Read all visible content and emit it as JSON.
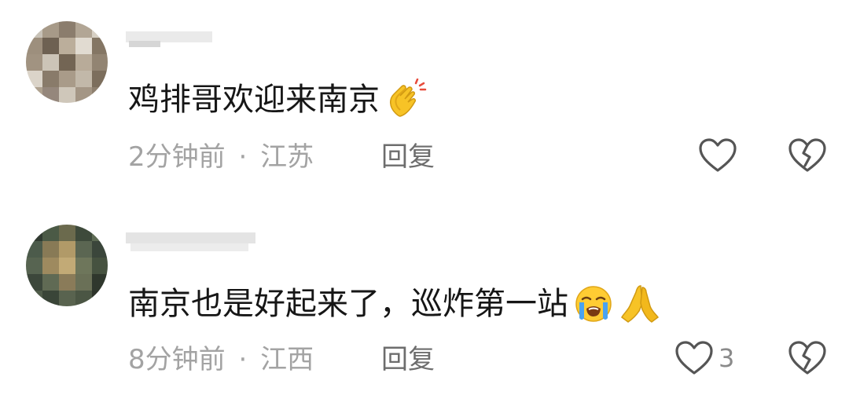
{
  "comments": [
    {
      "text": "鸡排哥欢迎来南京",
      "emojis": [
        "clapping-hands-emoji"
      ],
      "time": "2分钟前",
      "separator": "·",
      "location": "江苏",
      "reply_label": "回复",
      "like_count": ""
    },
    {
      "text": "南京也是好起来了，巡炸第一站",
      "emojis": [
        "loudly-crying-face-emoji",
        "folded-hands-emoji"
      ],
      "time": "8分钟前",
      "separator": "·",
      "location": "江西",
      "reply_label": "回复",
      "like_count": "3"
    }
  ],
  "colors": {
    "text": "#161616",
    "meta": "#a3a3a3",
    "reply": "#6d6d6d",
    "icon_stroke": "#555555"
  }
}
